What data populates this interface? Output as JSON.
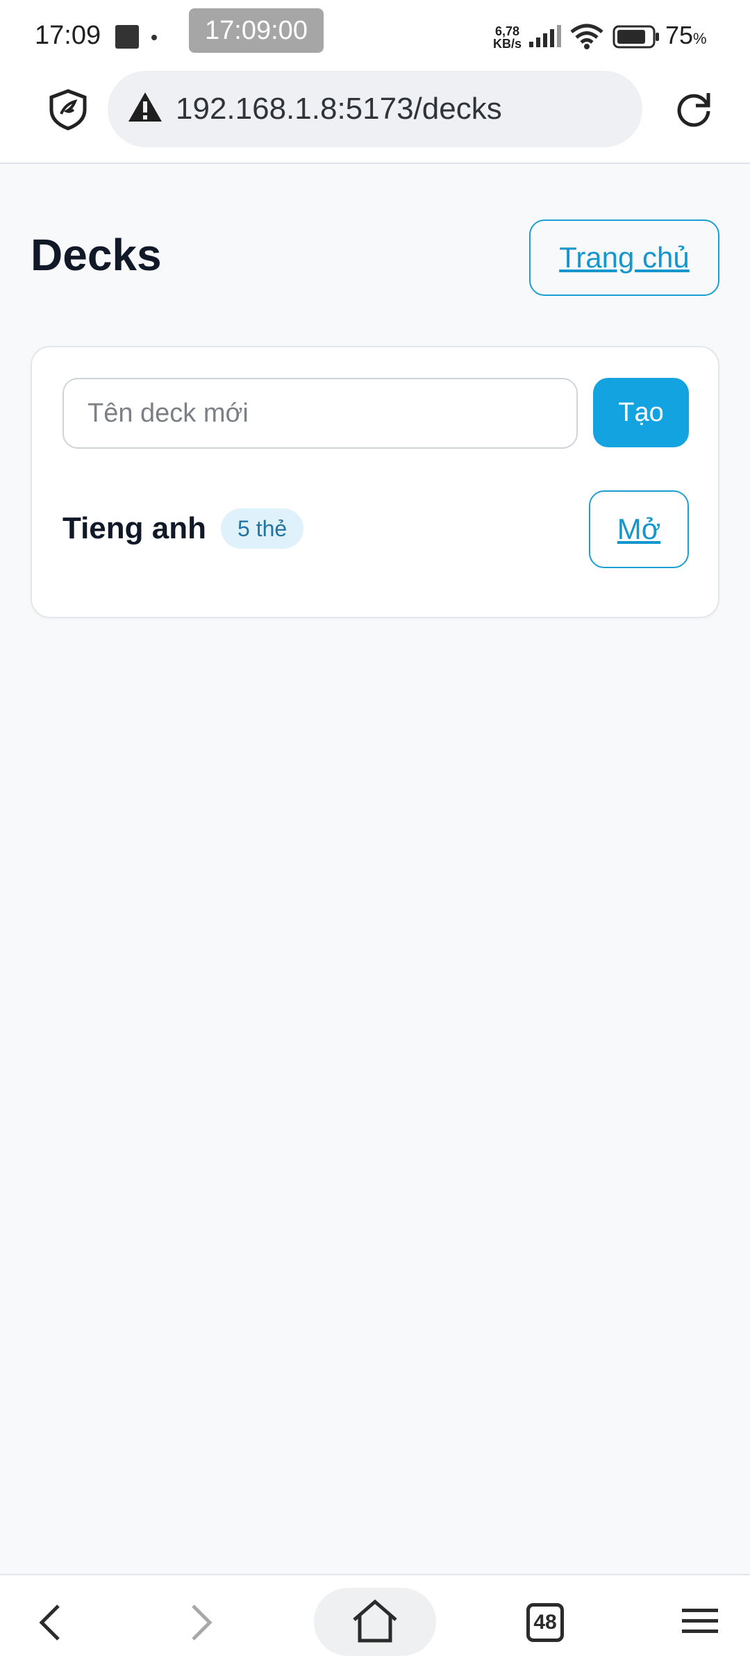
{
  "status_bar": {
    "time": "17:09",
    "clock_overlay": "17:09:00",
    "net_speed_value": "6,78",
    "net_speed_unit": "KB/s",
    "battery_value": "75",
    "battery_unit": "%",
    "icons": [
      "notification-square-icon",
      "dot-icon",
      "signal-icon",
      "wifi-icon",
      "battery-icon"
    ]
  },
  "browser": {
    "url": "192.168.1.8:5173/decks",
    "icons": [
      "shield-icon",
      "warning-icon",
      "reload-icon"
    ]
  },
  "page": {
    "title": "Decks",
    "home_button": "Trang chủ"
  },
  "create_deck": {
    "placeholder": "Tên deck mới",
    "value": "",
    "button": "Tạo"
  },
  "decks": [
    {
      "name": "Tieng anh",
      "badge": "5 thẻ",
      "open_button": "Mở"
    }
  ],
  "bottom_nav": {
    "tab_count": "48",
    "icons": [
      "back-icon",
      "forward-icon",
      "home-icon",
      "tabs-icon",
      "menu-icon"
    ]
  },
  "colors": {
    "accent": "#14a3e1",
    "outline_accent": "#1b9fd3",
    "badge_bg": "#dff1fb",
    "page_bg": "#f7f9fb"
  }
}
